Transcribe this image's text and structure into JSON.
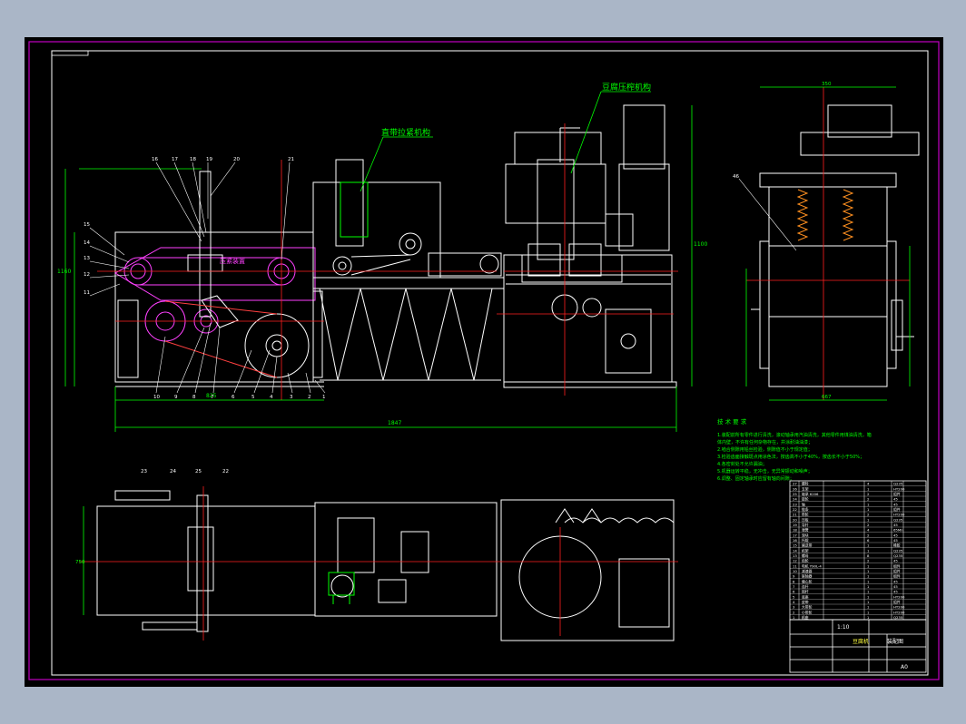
{
  "drawing": {
    "colors": {
      "background": "#000000",
      "frame": "#c000c0",
      "outline": "#ffffff",
      "centerline": "#ff2020",
      "dimension": "#00ff00",
      "highlight": "#ff40ff",
      "tag_line": "#00ff00"
    },
    "callouts": {
      "tofu_pressing": "豆腐压榨机构",
      "upper_belt": "直带拉紧机构",
      "upper_belt_alt": "压紧装置"
    },
    "part_numbers_top": [
      "16",
      "17",
      "18",
      "19",
      "20",
      "21"
    ],
    "part_numbers_left": [
      "15",
      "14",
      "13",
      "12",
      "11"
    ],
    "part_numbers_bottom": [
      "10",
      "9",
      "8",
      "7",
      "6",
      "5",
      "4",
      "3",
      "2",
      "1"
    ],
    "part_numbers_plan": [
      "23",
      "24",
      "25",
      "22"
    ],
    "part_number_side": "46",
    "dims": {
      "overall_width": "1847",
      "base_width": "825",
      "left_height": "1160",
      "side_width": "667",
      "side_top": "350",
      "right_height": "1100",
      "plan_depth": "750"
    },
    "notes_title": "技 术 要 求",
    "notes": [
      "1.装配前所有零件进行清洗，滚动轴承用汽油清洗，其他零件用煤油清洗，箱",
      "  体内壁，不许有任何杂物存在，并涂耐油油漆；",
      "2.啮合侧隙用铅丝检验，侧隙值不小于规定值；",
      "3.检验齿面接触斑点用涂色法，按齿高不小于40%，按齿长不小于50%；",
      "4.各密封处不允许漏油；",
      "5.机器运转平稳，无冲击，无异常振动和噪声；",
      "6.调整、固定轴承时应留有轴向间隙；"
    ],
    "title_block": {
      "drawing_name": "豆腐机",
      "sheet": "装配图",
      "scale": "1:10",
      "sheet_no": "A0"
    },
    "bom_rows": [
      "27 | 螺栓 | 4 | Q235",
      "26 | 支架 | 1 | HT200",
      "25 | 轴承 6206 | 2 | 组件",
      "24 | 链轮 | 2 | 45",
      "23 | 轴 | 1 | 45",
      "22 | 链条 | 1 | 组件",
      "21 | 带轮 | 2 | HT200",
      "20 | 压板 | 1 | Q235",
      "19 | 导杆 | 2 | 45",
      "18 | 弹簧 | 4 | 65Mn",
      "17 | 滑块 | 2 | 45",
      "16 | 托辊 | 6 | 45",
      "15 | 输送带 | 1 | 橡胶",
      "14 | 机架 | 1 | Q235",
      "13 | 螺母 | 8 | Q235",
      "12 | 齿轮 | 2 | 45",
      "11 | 电机 Y90L-4 | 1 | 组件",
      "10 | 减速器 | 1 | 组件",
      "9 | 联轴器 | 1 | 组件",
      "8 | 偏心轮 | 1 | 45",
      "7 | 连杆 | 1 | 45",
      "6 | 摇杆 | 1 | 45",
      "5 | 底座 | 1 | HT200",
      "4 | 皮带 | 1 | 组件",
      "3 | 大带轮 | 1 | HT200",
      "2 | 小带轮 | 1 | HT200",
      "1 | 机座 | 1 | Q235"
    ]
  }
}
